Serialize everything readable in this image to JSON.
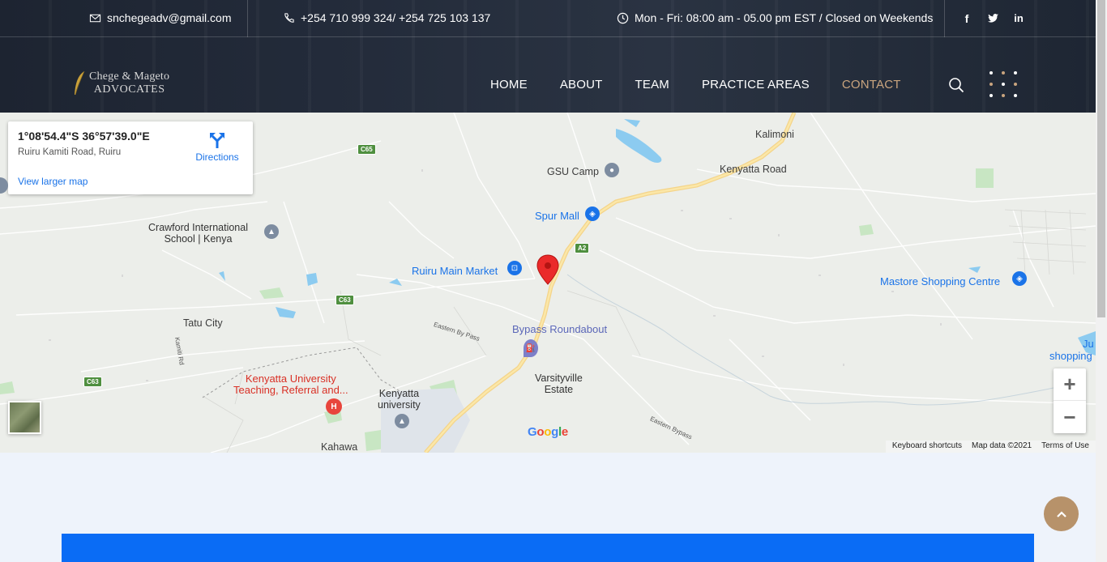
{
  "topbar": {
    "email": "snchegeadv@gmail.com",
    "phone": "+254 710 999 324/ +254 725 103 137",
    "hours": "Mon - Fri: 08:00 am - 05.00 pm EST / Closed on Weekends",
    "social": [
      "facebook-icon",
      "twitter-icon",
      "linkedin-icon"
    ]
  },
  "logo": {
    "line1": "Chege & Mageto",
    "line2": "ADVOCATES"
  },
  "nav": {
    "items": [
      {
        "label": "HOME"
      },
      {
        "label": "ABOUT"
      },
      {
        "label": "TEAM"
      },
      {
        "label": "PRACTICE AREAS"
      },
      {
        "label": "CONTACT",
        "active": true
      }
    ]
  },
  "map": {
    "coords": "1°08'54.4\"S 36°57'39.0\"E",
    "address": "Ruiru Kamiti Road, Ruiru",
    "larger_map": "View larger map",
    "directions": "Directions",
    "places": {
      "kalimoni": "Kalimoni",
      "gsu": "GSU Camp",
      "kenyatta_road": "Kenyatta Road",
      "spur": "Spur Mall",
      "crawford1": "Crawford International",
      "crawford2": "School | Kenya",
      "ruiru_market": "Ruiru Main Market",
      "mastore": "Mastore Shopping Centre",
      "tatu": "Tatu City",
      "bypass": "Bypass Roundabout",
      "varsity1": "Varsityville",
      "varsity2": "Estate",
      "ku_hospital1": "Kenyatta University",
      "ku_hospital2": "Teaching, Referral and...",
      "ku1": "Kenyatta",
      "ku2": "university",
      "kahawa": "Kahawa",
      "ju1": "Ju",
      "ju2": "shopping",
      "eastern1": "Eastern By Pass",
      "eastern2": "Eastern Bypass",
      "kamiti": "Kamiti Rd"
    },
    "shields": {
      "c65": "C65",
      "a2": "A2",
      "c63a": "C63",
      "c63b": "C63"
    },
    "google": [
      "G",
      "o",
      "o",
      "g",
      "l",
      "e"
    ],
    "footer": [
      "Keyboard shortcuts",
      "Map data ©2021",
      "Terms of Use"
    ],
    "zoom_in": "+",
    "zoom_out": "−"
  },
  "colors": {
    "accent": "#c9a47e",
    "link": "#1a73e8",
    "band": "#0a6cf5",
    "header": "#222a38"
  }
}
